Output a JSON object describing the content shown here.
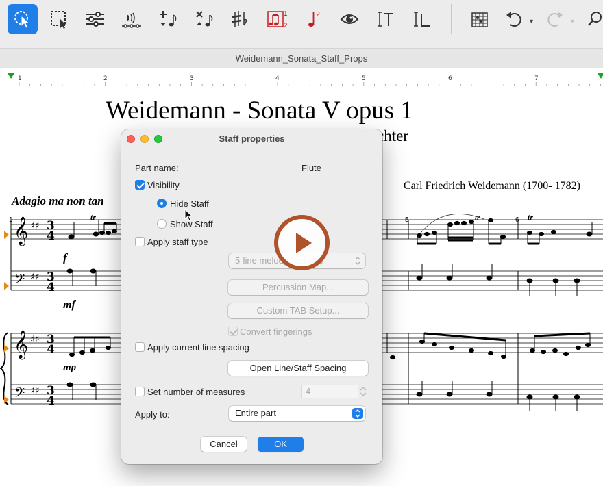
{
  "window": {
    "title": "Weidemann_Sonata_Staff_Props"
  },
  "toolbar": {
    "tools": [
      {
        "name": "selection-arrow",
        "selected": true
      },
      {
        "name": "marquee-select"
      },
      {
        "name": "mixer-sliders"
      },
      {
        "name": "speaker-playback"
      },
      {
        "name": "add-note"
      },
      {
        "name": "delete-note"
      },
      {
        "name": "accidentals"
      },
      {
        "name": "tuplet"
      },
      {
        "name": "note-color"
      },
      {
        "name": "eye-view"
      },
      {
        "name": "text-tool"
      },
      {
        "name": "lyrics-tool"
      },
      {
        "name": "chord-grid"
      },
      {
        "name": "undo"
      },
      {
        "name": "redo"
      },
      {
        "name": "search"
      }
    ],
    "accent_color": "#1f7ee8"
  },
  "ruler": {
    "numbers": [
      "1",
      "2",
      "3",
      "4",
      "5",
      "6",
      "7"
    ]
  },
  "score": {
    "title": "Weidemann - Sonata V opus 1",
    "arranger_fragment": "chter",
    "composer": "Carl Friedrich Weidemann (1700- 1782)",
    "tempo": "Adagio ma non tan",
    "measure_numbers": [
      "1",
      "5",
      "6"
    ],
    "dynamics": [
      "f",
      "mf",
      "mp"
    ],
    "ornament": "tr"
  },
  "dialog": {
    "title": "Staff properties",
    "part_name_label": "Part name:",
    "part_name_value": "Flute",
    "visibility_label": "Visibility",
    "visibility_checked": true,
    "hide_staff_label": "Hide Staff",
    "hide_staff_selected": true,
    "show_staff_label": "Show Staff",
    "apply_staff_type_label": "Apply staff type",
    "staff_type_value": "5-line melody (default)",
    "percussion_map_label": "Percussion Map...",
    "custom_tab_label": "Custom TAB Setup...",
    "convert_fingerings_label": "Convert fingerings",
    "apply_line_spacing_label": "Apply current line spacing",
    "open_spacing_label": "Open Line/Staff Spacing",
    "set_measures_label": "Set number of measures",
    "measures_value": "4",
    "apply_to_label": "Apply to:",
    "apply_to_value": "Entire part",
    "cancel_label": "Cancel",
    "ok_label": "OK"
  },
  "overlay": {
    "play_color": "#b0522a"
  }
}
